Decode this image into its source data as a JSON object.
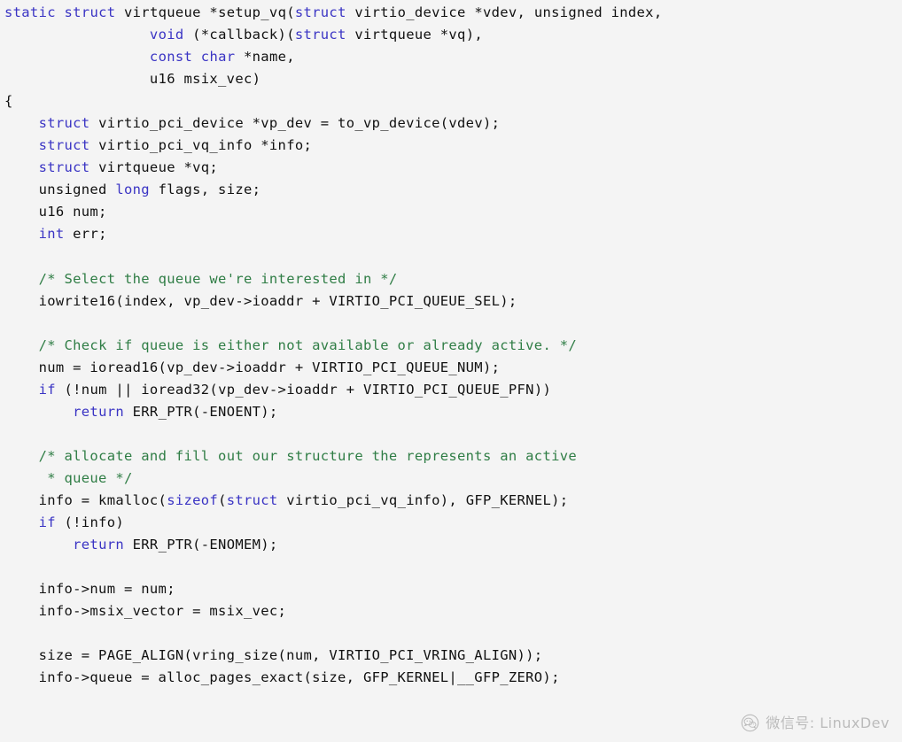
{
  "editor": {
    "language": "C",
    "background_color": "#f4f4f4",
    "keyword_color": "#3a34c4",
    "comment_color": "#2f7d45",
    "text_color": "#111111",
    "code_lines": [
      [
        {
          "t": "static",
          "c": "kw"
        },
        {
          "t": " ",
          "c": "pl"
        },
        {
          "t": "struct",
          "c": "kw"
        },
        {
          "t": " virtqueue *setup_vq(",
          "c": "pl"
        },
        {
          "t": "struct",
          "c": "kw"
        },
        {
          "t": " virtio_device *vdev, unsigned index,",
          "c": "pl"
        }
      ],
      [
        {
          "t": "                 ",
          "c": "pl"
        },
        {
          "t": "void",
          "c": "kw"
        },
        {
          "t": " (*callback)(",
          "c": "pl"
        },
        {
          "t": "struct",
          "c": "kw"
        },
        {
          "t": " virtqueue *vq),",
          "c": "pl"
        }
      ],
      [
        {
          "t": "                 ",
          "c": "pl"
        },
        {
          "t": "const",
          "c": "kw"
        },
        {
          "t": " ",
          "c": "pl"
        },
        {
          "t": "char",
          "c": "kw"
        },
        {
          "t": " *name,",
          "c": "pl"
        }
      ],
      [
        {
          "t": "                 u16 msix_vec)",
          "c": "pl"
        }
      ],
      [
        {
          "t": "{",
          "c": "pl"
        }
      ],
      [
        {
          "t": "    ",
          "c": "pl"
        },
        {
          "t": "struct",
          "c": "kw"
        },
        {
          "t": " virtio_pci_device *vp_dev = to_vp_device(vdev);",
          "c": "pl"
        }
      ],
      [
        {
          "t": "    ",
          "c": "pl"
        },
        {
          "t": "struct",
          "c": "kw"
        },
        {
          "t": " virtio_pci_vq_info *info;",
          "c": "pl"
        }
      ],
      [
        {
          "t": "    ",
          "c": "pl"
        },
        {
          "t": "struct",
          "c": "kw"
        },
        {
          "t": " virtqueue *vq;",
          "c": "pl"
        }
      ],
      [
        {
          "t": "    unsigned ",
          "c": "pl"
        },
        {
          "t": "long",
          "c": "kw"
        },
        {
          "t": " flags, size;",
          "c": "pl"
        }
      ],
      [
        {
          "t": "    u16 num;",
          "c": "pl"
        }
      ],
      [
        {
          "t": "    ",
          "c": "pl"
        },
        {
          "t": "int",
          "c": "kw"
        },
        {
          "t": " err;",
          "c": "pl"
        }
      ],
      [],
      [
        {
          "t": "    ",
          "c": "pl"
        },
        {
          "t": "/* Select the queue we're interested in */",
          "c": "cm"
        }
      ],
      [
        {
          "t": "    iowrite16(index, vp_dev->ioaddr + VIRTIO_PCI_QUEUE_SEL);",
          "c": "pl"
        }
      ],
      [],
      [
        {
          "t": "    ",
          "c": "pl"
        },
        {
          "t": "/* Check if queue is either not available or already active. */",
          "c": "cm"
        }
      ],
      [
        {
          "t": "    num = ioread16(vp_dev->ioaddr + VIRTIO_PCI_QUEUE_NUM);",
          "c": "pl"
        }
      ],
      [
        {
          "t": "    ",
          "c": "pl"
        },
        {
          "t": "if",
          "c": "kw"
        },
        {
          "t": " (!num || ioread32(vp_dev->ioaddr + VIRTIO_PCI_QUEUE_PFN))",
          "c": "pl"
        }
      ],
      [
        {
          "t": "        ",
          "c": "pl"
        },
        {
          "t": "return",
          "c": "kw"
        },
        {
          "t": " ERR_PTR(-ENOENT);",
          "c": "pl"
        }
      ],
      [],
      [
        {
          "t": "    ",
          "c": "pl"
        },
        {
          "t": "/* allocate and fill out our structure the represents an active",
          "c": "cm"
        }
      ],
      [
        {
          "t": "     * queue */",
          "c": "cm"
        }
      ],
      [
        {
          "t": "    info = kmalloc(",
          "c": "pl"
        },
        {
          "t": "sizeof",
          "c": "kw"
        },
        {
          "t": "(",
          "c": "pl"
        },
        {
          "t": "struct",
          "c": "kw"
        },
        {
          "t": " virtio_pci_vq_info), GFP_KERNEL);",
          "c": "pl"
        }
      ],
      [
        {
          "t": "    ",
          "c": "pl"
        },
        {
          "t": "if",
          "c": "kw"
        },
        {
          "t": " (!info)",
          "c": "pl"
        }
      ],
      [
        {
          "t": "        ",
          "c": "pl"
        },
        {
          "t": "return",
          "c": "kw"
        },
        {
          "t": " ERR_PTR(-ENOMEM);",
          "c": "pl"
        }
      ],
      [],
      [
        {
          "t": "    info->num = num;",
          "c": "pl"
        }
      ],
      [
        {
          "t": "    info->msix_vector = msix_vec;",
          "c": "pl"
        }
      ],
      [],
      [
        {
          "t": "    size = PAGE_ALIGN(vring_size(num, VIRTIO_PCI_VRING_ALIGN));",
          "c": "pl"
        }
      ],
      [
        {
          "t": "    info->queue = alloc_pages_exact(size, GFP_KERNEL|__GFP_ZERO);",
          "c": "pl"
        }
      ]
    ]
  },
  "watermark": {
    "icon": "wechat-icon",
    "text": "微信号: LinuxDev",
    "color": "#8d8d8d"
  }
}
